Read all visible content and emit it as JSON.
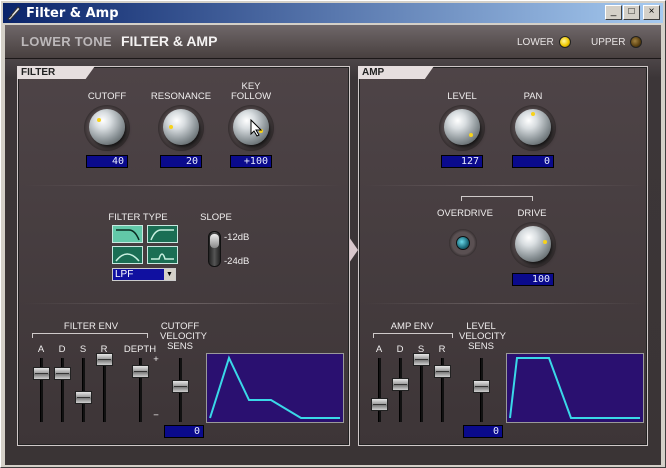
{
  "window": {
    "title": "Filter & Amp",
    "buttons": [
      "_",
      "□",
      "×"
    ]
  },
  "header": {
    "part": "LOWER TONE",
    "section": "FILTER & AMP",
    "lower_label": "LOWER",
    "upper_label": "UPPER",
    "lower_active": true,
    "upper_active": false
  },
  "filter": {
    "title": "FILTER",
    "cutoff": {
      "label": "CUTOFF",
      "value": "40"
    },
    "resonance": {
      "label": "RESONANCE",
      "value": "20"
    },
    "key_follow": {
      "label1": "KEY",
      "label2": "FOLLOW",
      "value": "+100"
    },
    "filter_type": {
      "label": "FILTER TYPE",
      "selected": "LPF"
    },
    "slope": {
      "label": "SLOPE",
      "opt1": "-12dB",
      "opt2": "-24dB",
      "selected": "-12dB"
    },
    "env": {
      "label": "FILTER ENV",
      "a": "A",
      "d": "D",
      "s": "S",
      "r": "R",
      "depth": "DEPTH",
      "plus": "+",
      "minus": "−"
    },
    "cutoff_vel": {
      "l1": "CUTOFF",
      "l2": "VELOCITY",
      "l3": "SENS",
      "value": "0"
    }
  },
  "amp": {
    "title": "AMP",
    "level": {
      "label": "LEVEL",
      "value": "127"
    },
    "pan": {
      "label": "PAN",
      "value": "0"
    },
    "overdrive": {
      "label": "OVERDRIVE"
    },
    "drive": {
      "label": "DRIVE",
      "value": "100"
    },
    "env": {
      "label": "AMP ENV",
      "a": "A",
      "d": "D",
      "s": "S",
      "r": "R"
    },
    "level_vel": {
      "l1": "LEVEL",
      "l2": "VELOCITY",
      "l3": "SENS",
      "value": "0"
    }
  },
  "colors": {
    "display_bg": "#0a0a8c",
    "env_bg": "#2a1070",
    "env_line": "#3ad8e8",
    "led_on": "#f0c800"
  }
}
